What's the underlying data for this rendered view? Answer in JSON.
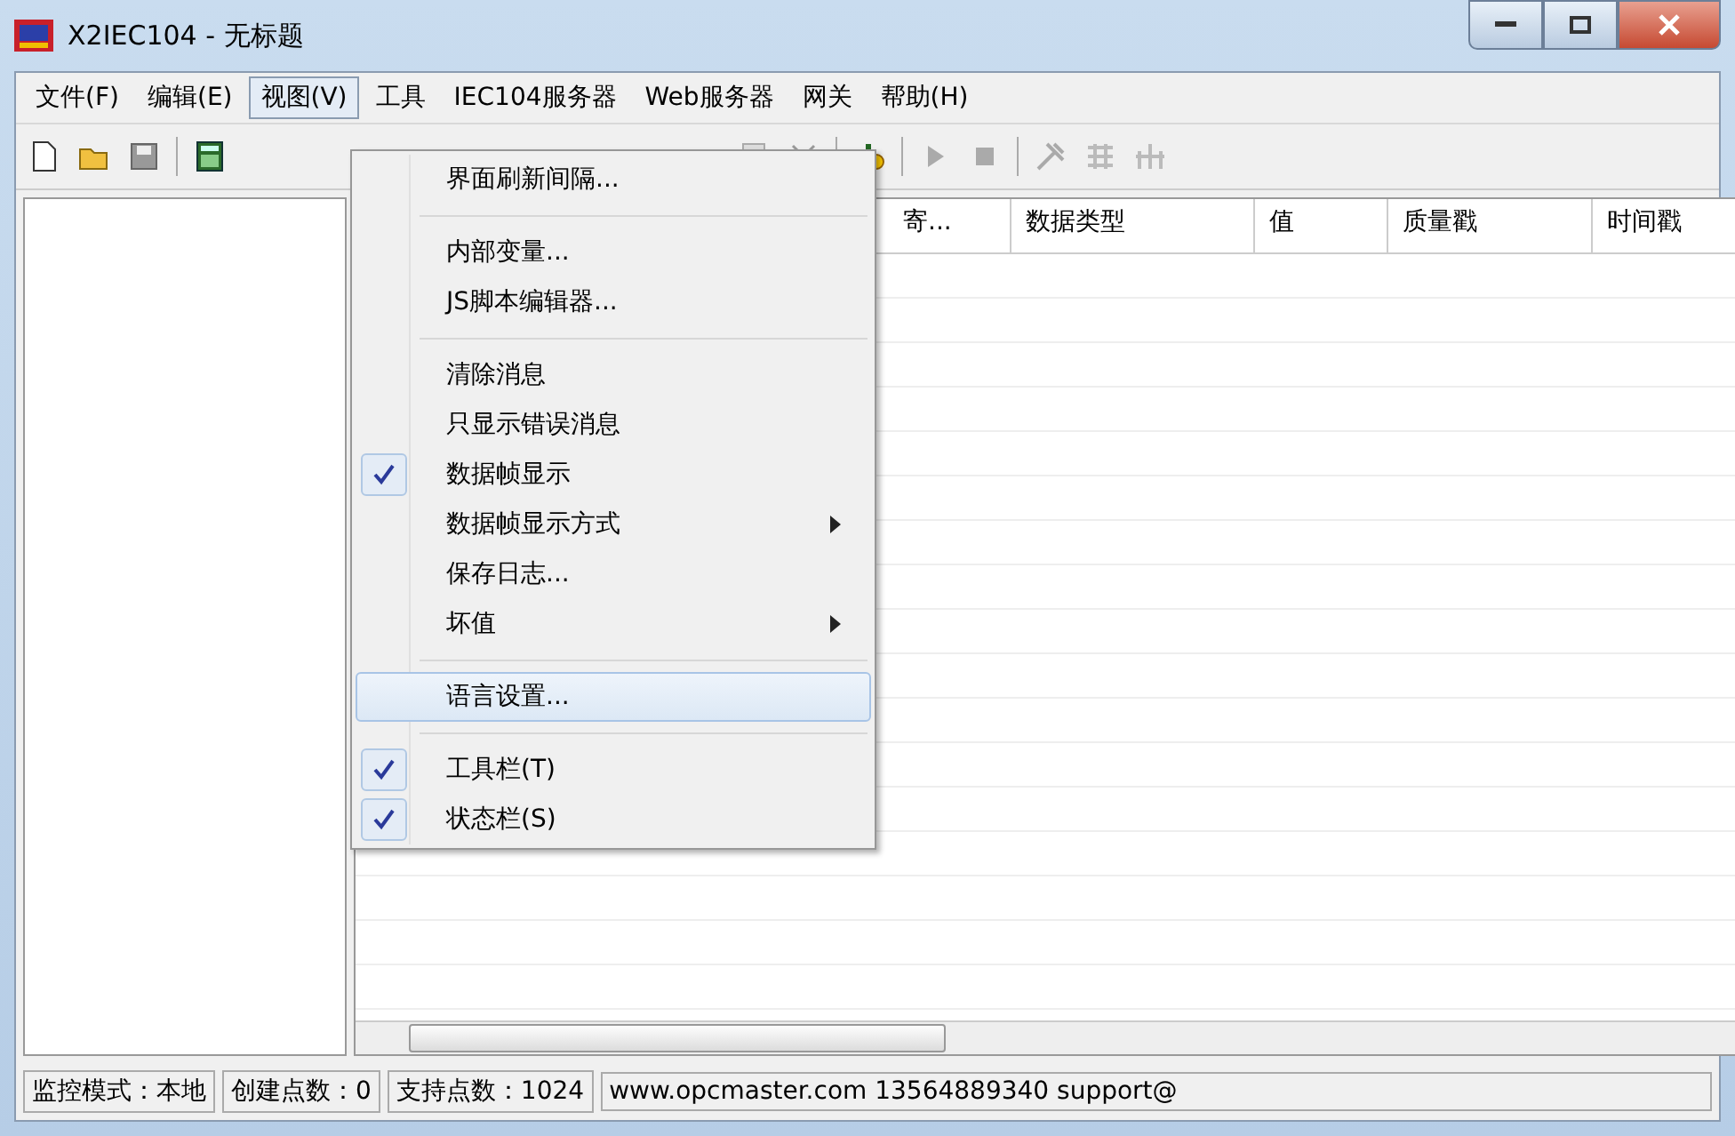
{
  "window": {
    "title": "X2IEC104 - 无标题"
  },
  "menu_bar": [
    {
      "label": "文件(F)",
      "selected": false
    },
    {
      "label": "编辑(E)",
      "selected": false
    },
    {
      "label": "视图(V)",
      "selected": true
    },
    {
      "label": "工具",
      "selected": false
    },
    {
      "label": "IEC104服务器",
      "selected": false
    },
    {
      "label": "Web服务器",
      "selected": false
    },
    {
      "label": "网关",
      "selected": false
    },
    {
      "label": "帮助(H)",
      "selected": false
    }
  ],
  "view_menu": [
    {
      "kind": "item",
      "label": "界面刷新间隔...",
      "checked": false,
      "submenu": false,
      "selected": false
    },
    {
      "kind": "separator"
    },
    {
      "kind": "item",
      "label": "内部变量...",
      "checked": false,
      "submenu": false,
      "selected": false
    },
    {
      "kind": "item",
      "label": "JS脚本编辑器...",
      "checked": false,
      "submenu": false,
      "selected": false
    },
    {
      "kind": "separator"
    },
    {
      "kind": "item",
      "label": "清除消息",
      "checked": false,
      "submenu": false,
      "selected": false
    },
    {
      "kind": "item",
      "label": "只显示错误消息",
      "checked": false,
      "submenu": false,
      "selected": false
    },
    {
      "kind": "item",
      "label": "数据帧显示",
      "checked": true,
      "submenu": false,
      "selected": false
    },
    {
      "kind": "item",
      "label": "数据帧显示方式",
      "checked": false,
      "submenu": true,
      "selected": false
    },
    {
      "kind": "item",
      "label": "保存日志...",
      "checked": false,
      "submenu": false,
      "selected": false
    },
    {
      "kind": "item",
      "label": "坏值",
      "checked": false,
      "submenu": true,
      "selected": false
    },
    {
      "kind": "separator"
    },
    {
      "kind": "item",
      "label": "语言设置...",
      "checked": false,
      "submenu": false,
      "selected": true
    },
    {
      "kind": "separator"
    },
    {
      "kind": "item",
      "label": "工具栏(T)",
      "checked": true,
      "submenu": false,
      "selected": false
    },
    {
      "kind": "item",
      "label": "状态栏(S)",
      "checked": true,
      "submenu": false,
      "selected": false
    }
  ],
  "table": {
    "columns": [
      "寄...",
      "数据类型",
      "值",
      "质量戳",
      "时间戳"
    ]
  },
  "status_bar": [
    "监控模式：本地",
    "创建点数：0",
    "支持点数：1024",
    "www.opcmaster.com 13564889340 support@"
  ]
}
